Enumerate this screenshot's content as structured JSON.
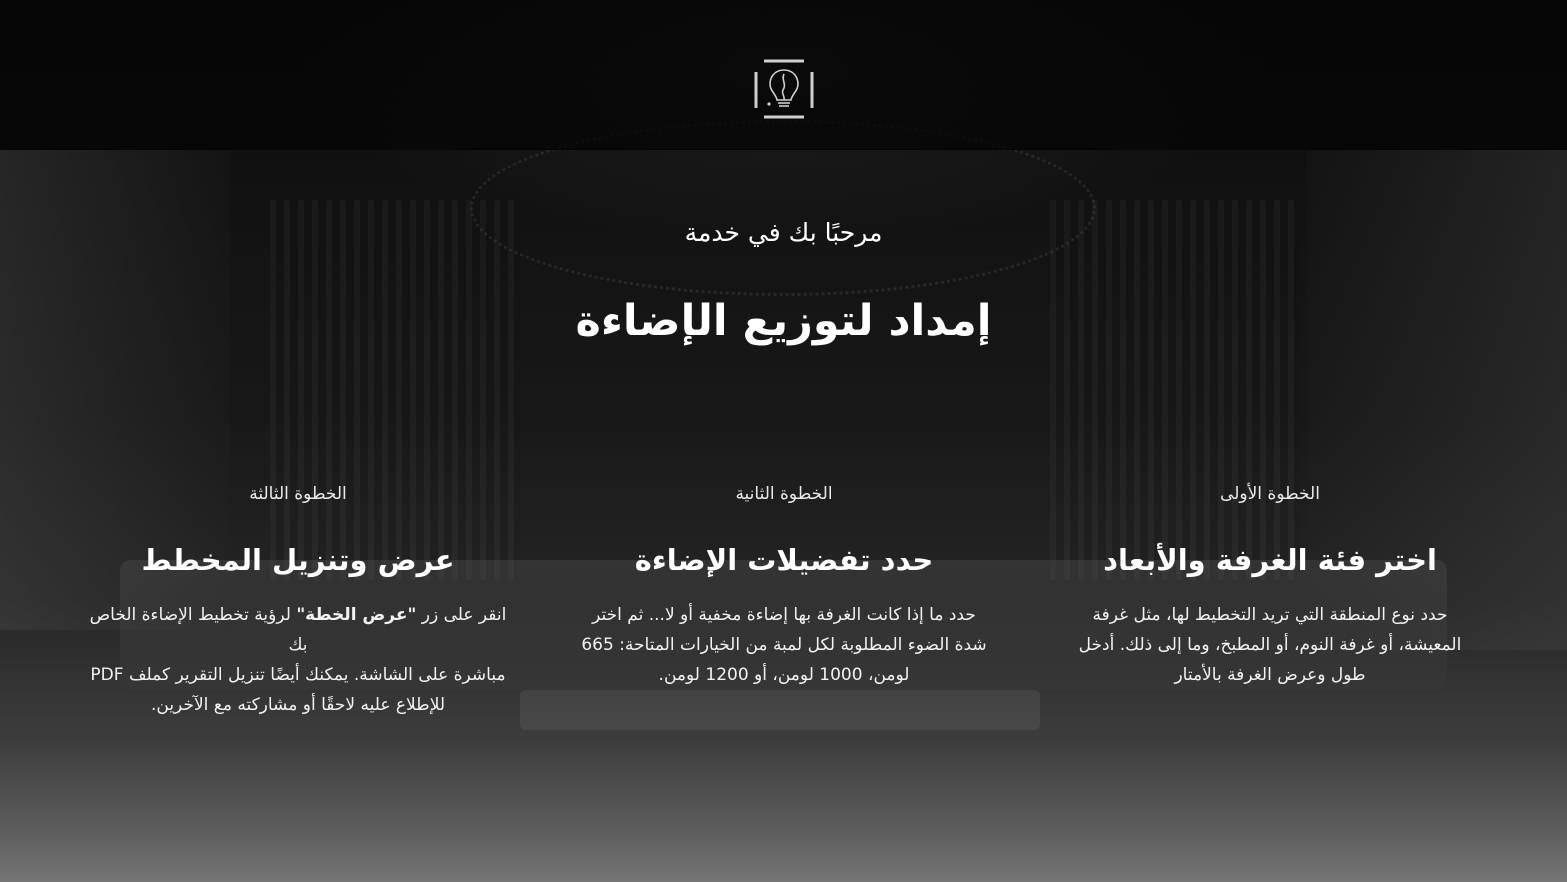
{
  "header": {
    "logo_icon": "lightbulb-logo-icon"
  },
  "hero": {
    "subtitle": "مرحبًا بك في خدمة",
    "title": "إمداد لتوزيع الإضاءة"
  },
  "steps": [
    {
      "label": "الخطوة الأولى",
      "title": "اختر فئة الغرفة والأبعاد",
      "description_lines": [
        "حدد نوع المنطقة التي تريد التخطيط لها، مثل غرفة",
        "المعيشة، أو غرفة النوم، أو المطبخ، وما إلى ذلك. أدخل",
        "طول وعرض الغرفة بالأمتار"
      ]
    },
    {
      "label": "الخطوة الثانية",
      "title": "حدد تفضيلات الإضاءة",
      "description_lines": [
        "حدد ما إذا كانت الغرفة بها إضاءة مخفية أو لا... ثم اختر",
        "شدة الضوء المطلوبة لكل لمبة من الخيارات المتاحة: 665",
        "لومن، 1000 لومن، أو 1200 لومن."
      ]
    },
    {
      "label": "الخطوة الثالثة",
      "title": "عرض وتنزيل المخطط",
      "description_prefix": "انقر على زر ",
      "description_bold": "\"عرض الخطة\"",
      "description_suffix": " لرؤية تخطيط الإضاءة الخاص بك",
      "description_lines": [
        "مباشرة على الشاشة. يمكنك أيضًا تنزيل التقرير كملف PDF",
        "للإطلاع عليه لاحقًا أو مشاركته مع الآخرين."
      ]
    }
  ]
}
